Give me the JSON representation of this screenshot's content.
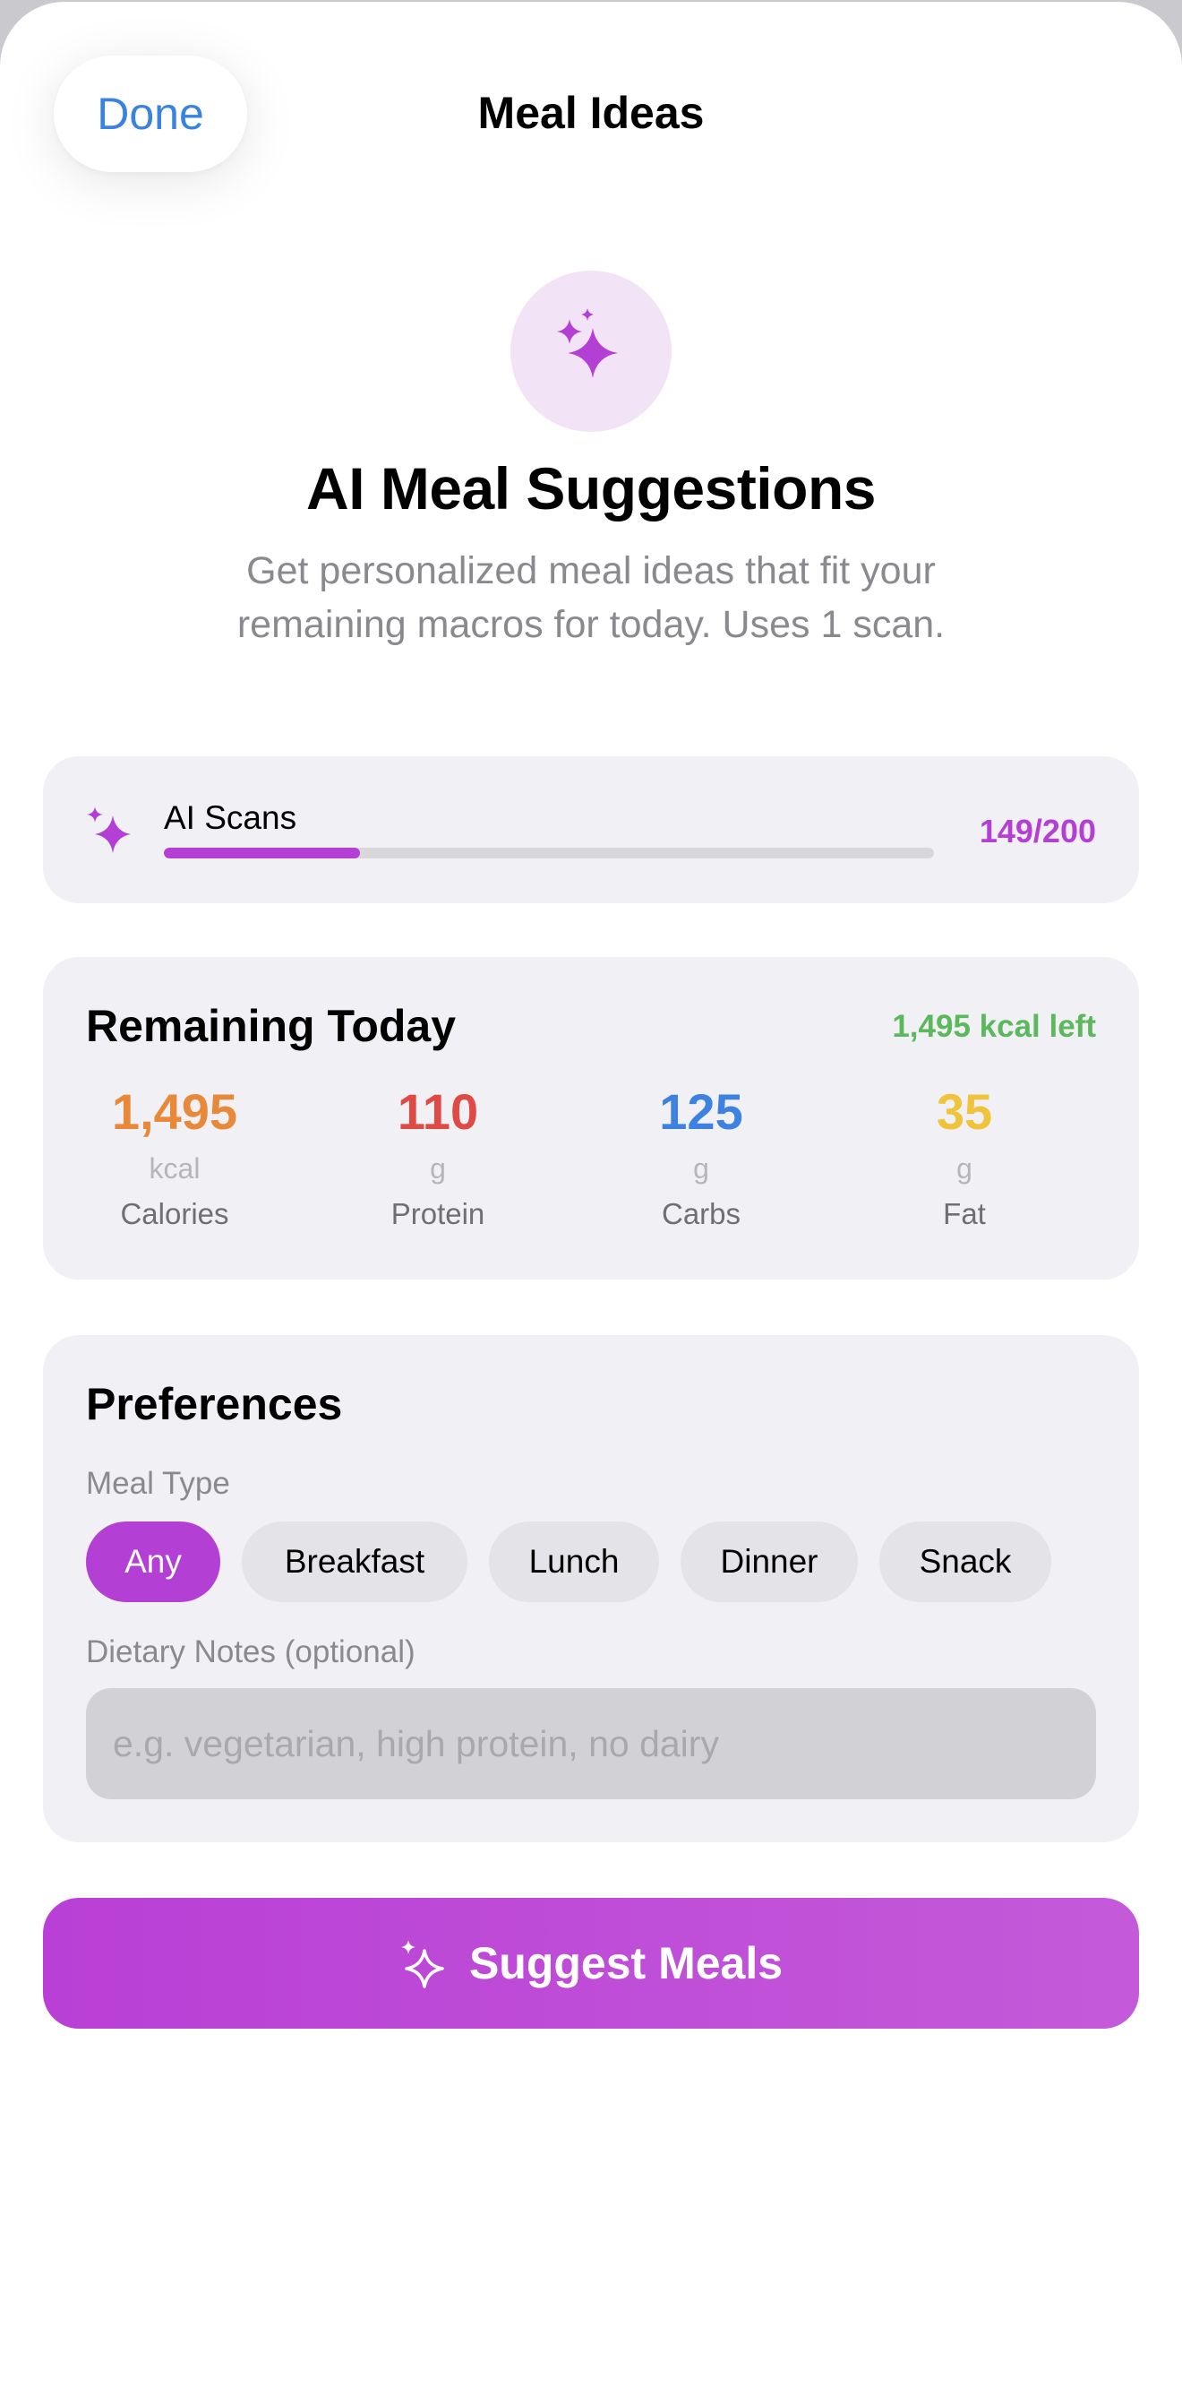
{
  "nav": {
    "done_label": "Done",
    "title": "Meal Ideas"
  },
  "hero": {
    "icon": "sparkles-icon",
    "title": "AI Meal Suggestions",
    "subtitle": "Get personalized meal ideas that fit your remaining macros for today. Uses 1 scan."
  },
  "scans": {
    "icon": "sparkles-icon",
    "label": "AI Scans",
    "count_text": "149/200",
    "used_fraction": 0.255
  },
  "remaining": {
    "title": "Remaining Today",
    "kcal_left": "1,495 kcal left",
    "macros": [
      {
        "value": "1,495",
        "unit": "kcal",
        "label": "Calories",
        "color": "#e8893a"
      },
      {
        "value": "110",
        "unit": "g",
        "label": "Protein",
        "color": "#e04a44"
      },
      {
        "value": "125",
        "unit": "g",
        "label": "Carbs",
        "color": "#3d82e0"
      },
      {
        "value": "35",
        "unit": "g",
        "label": "Fat",
        "color": "#f0c43a"
      }
    ]
  },
  "preferences": {
    "title": "Preferences",
    "meal_type_label": "Meal Type",
    "meal_types": [
      "Any",
      "Breakfast",
      "Lunch",
      "Dinner",
      "Snack"
    ],
    "selected_meal_type": "Any",
    "dietary_label": "Dietary Notes (optional)",
    "dietary_value": "",
    "dietary_placeholder": "e.g. vegetarian, high protein, no dairy"
  },
  "action": {
    "icon": "sparkles-icon",
    "label": "Suggest Meals"
  },
  "colors": {
    "accent": "#b43fd4",
    "link": "#3a82e0",
    "success": "#5cb85c"
  }
}
